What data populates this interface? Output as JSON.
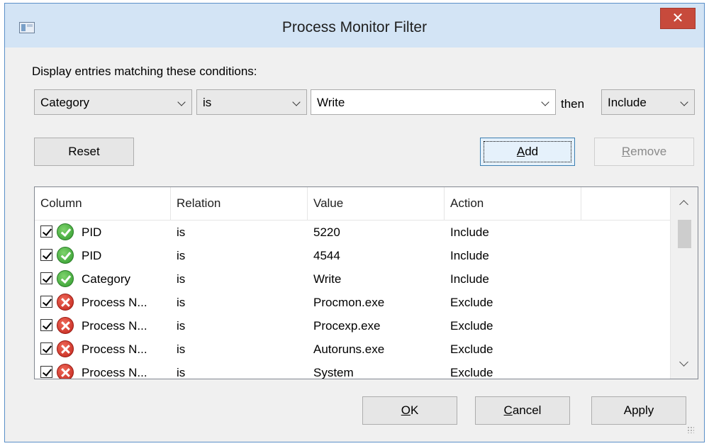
{
  "window": {
    "title": "Process Monitor Filter",
    "close_glyph": "✕"
  },
  "conditions": {
    "label": "Display entries matching these conditions:",
    "column": "Category",
    "relation": "is",
    "value": "Write",
    "then": "then",
    "action": "Include"
  },
  "buttons": {
    "reset": "Reset",
    "add_ul": "A",
    "add_rest": "dd",
    "remove_ul": "R",
    "remove_rest": "emove",
    "ok_ul": "O",
    "ok_rest": "K",
    "cancel_ul": "C",
    "cancel_rest": "ancel",
    "apply": "Apply"
  },
  "list": {
    "headers": [
      "Column",
      "Relation",
      "Value",
      "Action"
    ],
    "rows": [
      {
        "checked": true,
        "status": "include",
        "column": "PID",
        "relation": "is",
        "value": "5220",
        "action": "Include"
      },
      {
        "checked": true,
        "status": "include",
        "column": "PID",
        "relation": "is",
        "value": "4544",
        "action": "Include"
      },
      {
        "checked": true,
        "status": "include",
        "column": "Category",
        "relation": "is",
        "value": "Write",
        "action": "Include"
      },
      {
        "checked": true,
        "status": "exclude",
        "column": "Process N...",
        "relation": "is",
        "value": "Procmon.exe",
        "action": "Exclude"
      },
      {
        "checked": true,
        "status": "exclude",
        "column": "Process N...",
        "relation": "is",
        "value": "Procexp.exe",
        "action": "Exclude"
      },
      {
        "checked": true,
        "status": "exclude",
        "column": "Process N...",
        "relation": "is",
        "value": "Autoruns.exe",
        "action": "Exclude"
      },
      {
        "checked": true,
        "status": "exclude",
        "column": "Process N...",
        "relation": "is",
        "value": "System",
        "action": "Exclude"
      }
    ]
  },
  "colors": {
    "title_bar": "#d3e4f5",
    "close_button": "#c74a3c",
    "include_icon": "#2f9a2c",
    "exclude_icon": "#c0231a"
  },
  "icons": {
    "include": "green-check-circle-icon",
    "exclude": "red-x-circle-icon"
  }
}
